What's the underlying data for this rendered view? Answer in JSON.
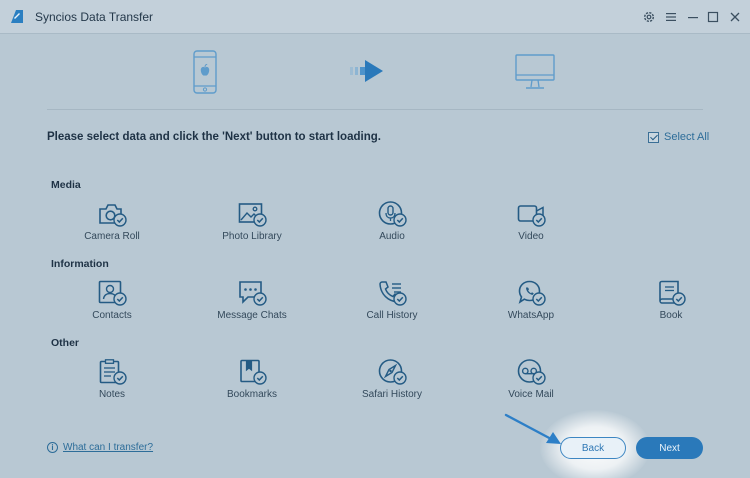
{
  "window": {
    "title": "Syncios Data Transfer",
    "controls": [
      "settings-icon",
      "menu-icon",
      "minimize-icon",
      "maximize-icon",
      "close-icon"
    ]
  },
  "header": {
    "source_device": "iphone-icon",
    "arrow": "right-arrow-icon",
    "target_device": "computer-monitor-icon"
  },
  "instructions": "Please select data and click the 'Next' button to start loading.",
  "select_all": {
    "label": "Select All",
    "checked": true
  },
  "categories": [
    {
      "title": "Media",
      "items": [
        {
          "label": "Camera Roll",
          "icon": "camera-icon",
          "checked": true
        },
        {
          "label": "Photo Library",
          "icon": "photo-icon",
          "checked": true
        },
        {
          "label": "Audio",
          "icon": "microphone-icon",
          "checked": true
        },
        {
          "label": "Video",
          "icon": "video-icon",
          "checked": true
        }
      ]
    },
    {
      "title": "Information",
      "items": [
        {
          "label": "Contacts",
          "icon": "contacts-icon",
          "checked": true
        },
        {
          "label": "Message Chats",
          "icon": "chat-icon",
          "checked": true
        },
        {
          "label": "Call History",
          "icon": "phone-list-icon",
          "checked": true
        },
        {
          "label": "WhatsApp",
          "icon": "whatsapp-icon",
          "checked": true
        },
        {
          "label": "Book",
          "icon": "book-icon",
          "checked": true
        }
      ]
    },
    {
      "title": "Other",
      "items": [
        {
          "label": "Notes",
          "icon": "notes-icon",
          "checked": true
        },
        {
          "label": "Bookmarks",
          "icon": "bookmark-icon",
          "checked": true
        },
        {
          "label": "Safari History",
          "icon": "compass-icon",
          "checked": true
        },
        {
          "label": "Voice Mail",
          "icon": "voicemail-icon",
          "checked": true
        }
      ]
    }
  ],
  "footer": {
    "help_link": "What can I transfer?",
    "back_label": "Back",
    "next_label": "Next"
  },
  "colors": {
    "accent": "#2a79ba",
    "icon": "#245b84",
    "background": "#b8c8d3"
  }
}
